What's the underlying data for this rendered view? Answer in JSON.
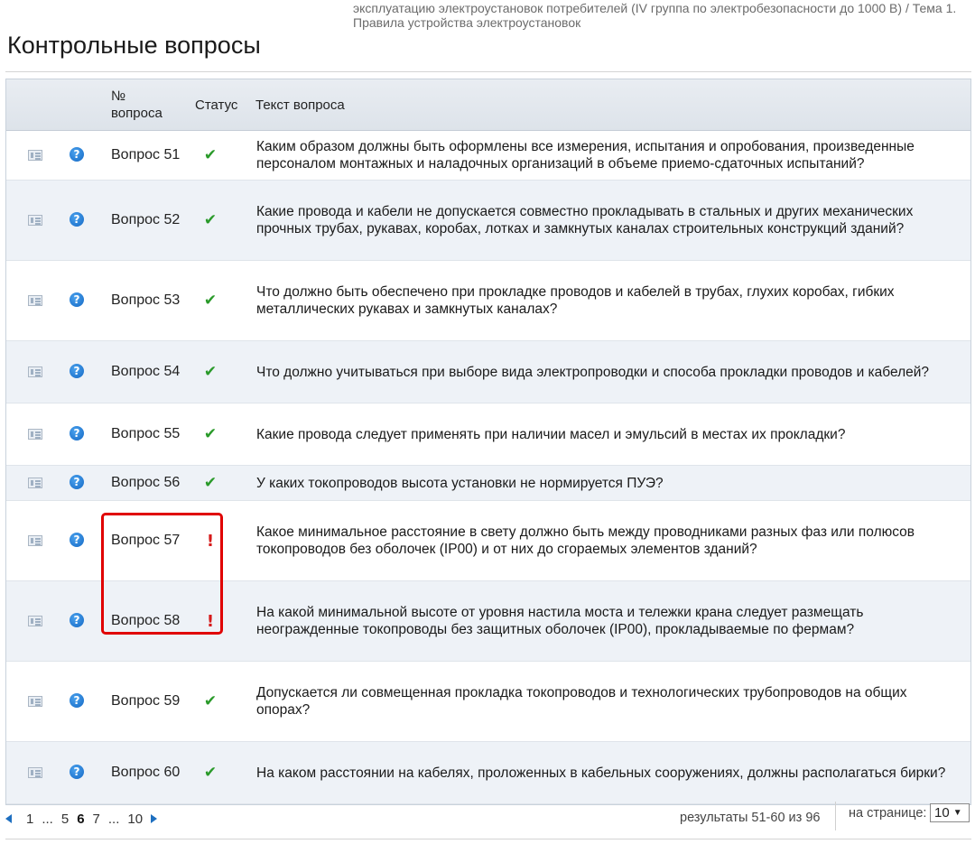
{
  "breadcrumb": "эксплуатацию электроустановок потребителей (IV группа по электробезопасности до 1000 В)  /  Тема 1. Правила устройства электроустановок",
  "page_title": "Контрольные вопросы",
  "table": {
    "headers": {
      "number": "№ вопроса",
      "status": "Статус",
      "text": "Текст вопроса"
    },
    "rows": [
      {
        "number": "Вопрос 51",
        "status": "✔",
        "status_kind": "ok",
        "text": "Каким образом должны быть оформлены все измерения, испытания и опробования, произведенные персоналом монтажных и наладочных организаций в объеме приемо-сдаточных испытаний?"
      },
      {
        "number": "Вопрос 52",
        "status": "✔",
        "status_kind": "ok",
        "text": "Какие провода и кабели не допускается совместно прокладывать в стальных и других механических прочных трубах, рукавах, коробах, лотках и замкнутых каналах строительных конструкций зданий?"
      },
      {
        "number": "Вопрос 53",
        "status": "✔",
        "status_kind": "ok",
        "text": "Что должно быть обеспечено при прокладке проводов и кабелей в трубах, глухих коробах, гибких металлических рукавах и замкнутых каналах?"
      },
      {
        "number": "Вопрос 54",
        "status": "✔",
        "status_kind": "ok",
        "text": "Что должно учитываться при выборе вида электропроводки и способа прокладки проводов и кабелей?"
      },
      {
        "number": "Вопрос 55",
        "status": "✔",
        "status_kind": "ok",
        "text": "Какие провода следует применять при наличии масел и эмульсий в местах их прокладки?"
      },
      {
        "number": "Вопрос 56",
        "status": "✔",
        "status_kind": "ok",
        "text": "У каких токопроводов высота установки не нормируется ПУЭ?"
      },
      {
        "number": "Вопрос 57",
        "status": "!",
        "status_kind": "warn",
        "text": "Какое минимальное расстояние в свету должно быть между проводниками разных фаз или полюсов токопроводов без оболочек (IP00) и от них до сгораемых элементов зданий?"
      },
      {
        "number": "Вопрос 58",
        "status": "!",
        "status_kind": "warn",
        "text": "На какой минимальной высоте от уровня настила моста и тележки крана следует размещать неогражденные токопроводы без защитных оболочек (IP00), прокладываемые по фермам?"
      },
      {
        "number": "Вопрос 59",
        "status": "✔",
        "status_kind": "ok",
        "text": "Допускается ли совмещенная прокладка токопроводов и технологических трубопроводов на общих опорах?"
      },
      {
        "number": "Вопрос 60",
        "status": "✔",
        "status_kind": "ok",
        "text": "На каком расстоянии на кабелях, проложенных в кабельных сооружениях, должны располагаться бирки?"
      }
    ]
  },
  "pagination": {
    "pages": [
      "1",
      "...",
      "5",
      "6",
      "7",
      "...",
      "10"
    ],
    "current": "6",
    "results_text": "результаты 51-60 из 96",
    "per_page_label": "на странице:",
    "per_page_value": "10"
  },
  "colors": {
    "ok": "#2a9a2a",
    "warn": "#d61a1a",
    "highlight": "#e00000",
    "header_bg": "#e3e8ee",
    "alt_row": "#eef2f7"
  },
  "icons": {
    "row_doc": "document-list-icon",
    "row_help": "help-question-icon",
    "prev": "triangle-left-icon",
    "next": "triangle-right-icon"
  }
}
